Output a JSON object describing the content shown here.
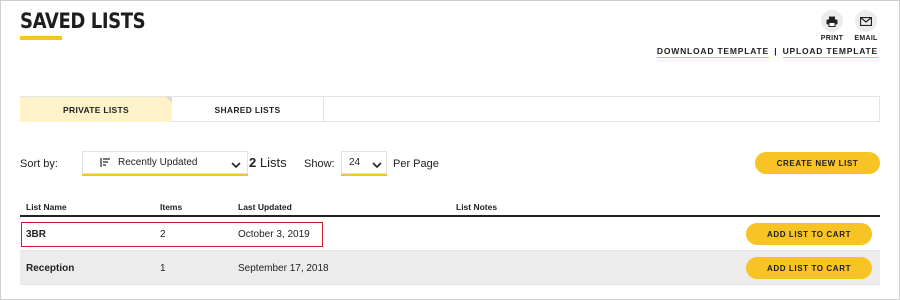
{
  "page": {
    "title": "SAVED LISTS"
  },
  "actions": {
    "print_label": "PRINT",
    "email_label": "EMAIL"
  },
  "templates": {
    "download_label": "DOWNLOAD TEMPLATE",
    "separator": "|",
    "upload_label": "UPLOAD TEMPLATE"
  },
  "tabs": [
    {
      "label": "PRIVATE LISTS",
      "active": true
    },
    {
      "label": "SHARED LISTS",
      "active": false
    }
  ],
  "toolbar": {
    "sort_label": "Sort by:",
    "sort_value": "Recently Updated",
    "count_number": "2",
    "count_suffix": "Lists",
    "show_label": "Show:",
    "show_value": "24",
    "per_page_label": "Per Page",
    "create_label": "CREATE NEW LIST"
  },
  "table": {
    "headers": [
      "List Name",
      "Items",
      "Last Updated",
      "List Notes"
    ],
    "rows": [
      {
        "name": "3BR",
        "items": "2",
        "updated": "October 3, 2019",
        "notes": "",
        "action": "ADD LIST TO CART",
        "highlighted": true
      },
      {
        "name": "Reception",
        "items": "1",
        "updated": "September 17, 2018",
        "notes": "",
        "action": "ADD LIST TO CART",
        "highlighted": false
      }
    ]
  },
  "colors": {
    "accent": "#f7c325",
    "active_tab": "#fdf2c8",
    "highlight_border": "#d01a2a",
    "alt_row": "#ececec"
  }
}
